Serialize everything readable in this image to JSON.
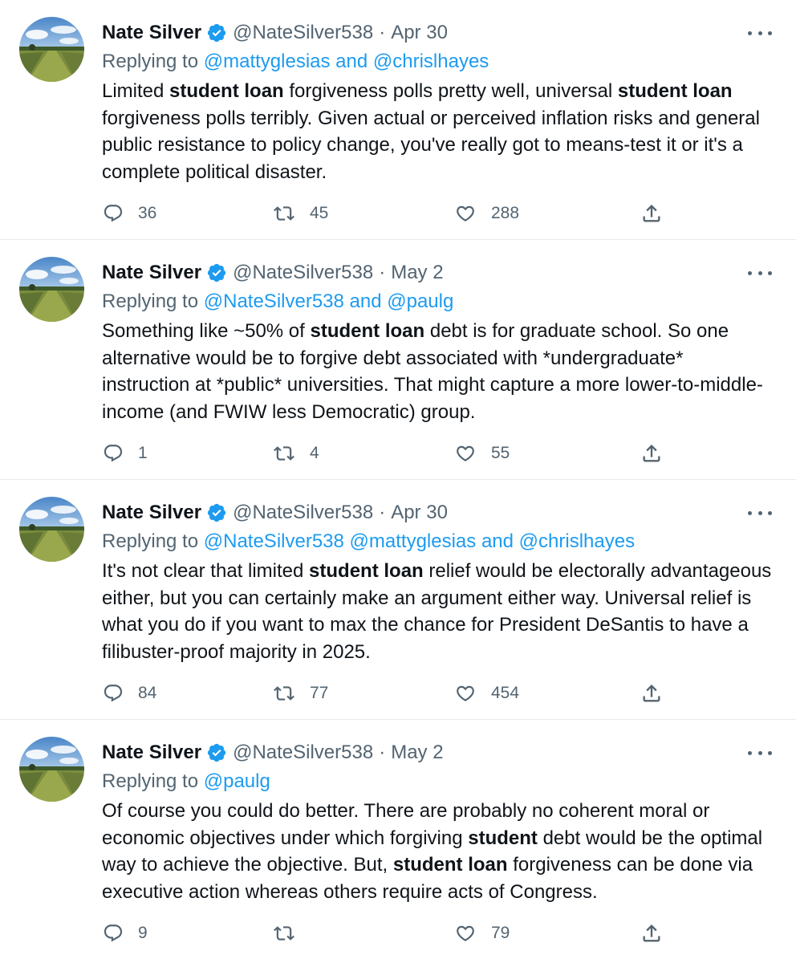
{
  "tweets": [
    {
      "name": "Nate Silver",
      "handle": "@NateSilver538",
      "separator": "·",
      "date": "Apr 30",
      "replying_label": "Replying to",
      "replying_to": "@mattyglesias and @chrislhayes",
      "body": [
        {
          "t": "Limited "
        },
        {
          "t": "student loan",
          "b": true
        },
        {
          "t": " forgiveness polls pretty well, universal "
        },
        {
          "t": "student loan",
          "b": true
        },
        {
          "t": " forgiveness polls terribly. Given actual or perceived inflation risks and general public resistance to policy change, you've really got to means-test it or it's a complete political disaster."
        }
      ],
      "replies": "36",
      "retweets": "45",
      "likes": "288"
    },
    {
      "name": "Nate Silver",
      "handle": "@NateSilver538",
      "separator": "·",
      "date": "May 2",
      "replying_label": "Replying to",
      "replying_to": "@NateSilver538 and @paulg",
      "body": [
        {
          "t": "Something like ~50% of "
        },
        {
          "t": "student loan",
          "b": true
        },
        {
          "t": " debt is for graduate school. So one alternative would be to forgive debt associated with *undergraduate* instruction at *public* universities. That might capture a more lower-to-middle-income (and FWIW less Democratic) group."
        }
      ],
      "replies": "1",
      "retweets": "4",
      "likes": "55"
    },
    {
      "name": "Nate Silver",
      "handle": "@NateSilver538",
      "separator": "·",
      "date": "Apr 30",
      "replying_label": "Replying to",
      "replying_to": "@NateSilver538 @mattyglesias and @chrislhayes",
      "body": [
        {
          "t": "It's not clear that limited "
        },
        {
          "t": "student loan",
          "b": true
        },
        {
          "t": " relief would be electorally advantageous either, but you can certainly make an argument either way. Universal relief is what you do if you want to max the chance for President DeSantis to have a filibuster-proof majority in 2025."
        }
      ],
      "replies": "84",
      "retweets": "77",
      "likes": "454"
    },
    {
      "name": "Nate Silver",
      "handle": "@NateSilver538",
      "separator": "·",
      "date": "May 2",
      "replying_label": "Replying to",
      "replying_to": "@paulg",
      "body": [
        {
          "t": "Of course you could do better. There are probably no coherent moral or economic objectives under which forgiving "
        },
        {
          "t": "student",
          "b": true
        },
        {
          "t": " debt would be the optimal way to achieve the objective. But, "
        },
        {
          "t": "student loan",
          "b": true
        },
        {
          "t": " forgiveness can be done via executive action whereas others require acts of Congress."
        }
      ],
      "replies": "9",
      "retweets": "",
      "likes": "79"
    }
  ],
  "colors": {
    "text": "#0f1419",
    "secondary": "#536471",
    "link": "#1d9bf0",
    "divider": "#e6ecf0"
  },
  "icons": [
    "verified-badge-icon",
    "more-options-icon",
    "reply-icon",
    "retweet-icon",
    "like-icon",
    "share-icon"
  ]
}
